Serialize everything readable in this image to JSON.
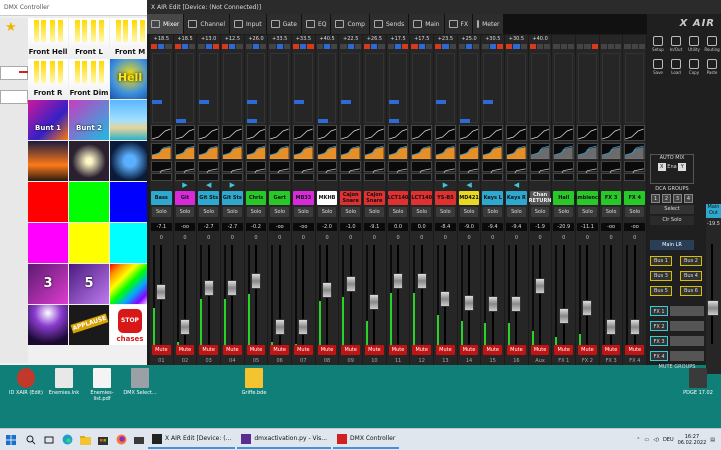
{
  "dmx": {
    "title": "DMX Controller",
    "tiles": [
      {
        "label": "Front Hell",
        "kind": "light"
      },
      {
        "label": "Front L",
        "kind": "light"
      },
      {
        "label": "Front M",
        "kind": "light"
      },
      {
        "label": "Front R",
        "kind": "light"
      },
      {
        "label": "Front Dim",
        "kind": "light"
      },
      {
        "label": "Hell",
        "kind": "hell"
      },
      {
        "label": "Bunt 1",
        "kind": "bunt1"
      },
      {
        "label": "Bunt 2",
        "kind": "bunt2"
      },
      {
        "label": "",
        "kind": "beach"
      },
      {
        "label": "",
        "kind": "sunset"
      },
      {
        "label": "",
        "kind": "moon"
      },
      {
        "label": "",
        "kind": "earth"
      },
      {
        "label": "",
        "kind": "red"
      },
      {
        "label": "",
        "kind": "green"
      },
      {
        "label": "",
        "kind": "blue"
      },
      {
        "label": "",
        "kind": "magenta"
      },
      {
        "label": "",
        "kind": "yellow"
      },
      {
        "label": "",
        "kind": "cyan"
      },
      {
        "label": "3",
        "kind": "three"
      },
      {
        "label": "5",
        "kind": "five"
      },
      {
        "label": "",
        "kind": "rainbow"
      },
      {
        "label": "",
        "kind": "crowd"
      },
      {
        "label": "",
        "kind": "applause"
      },
      {
        "label": "chases",
        "kind": "chases"
      }
    ],
    "applause_text": "APPLAUSE",
    "stop_text": "STOP"
  },
  "xair": {
    "title": "X AIR Edit [Device: (Not Connected)]",
    "tabs": [
      {
        "label": "Mixer",
        "active": true
      },
      {
        "label": "Channel",
        "active": false
      },
      {
        "label": "Input",
        "active": false
      },
      {
        "label": "Gate",
        "active": false
      },
      {
        "label": "EQ",
        "active": false
      },
      {
        "label": "Comp",
        "active": false
      },
      {
        "label": "Sends",
        "active": false
      },
      {
        "label": "Main",
        "active": false
      },
      {
        "label": "FX",
        "active": false
      },
      {
        "label": "Meter",
        "active": false
      }
    ],
    "logo": "X AIR",
    "channels": [
      {
        "gain": "+18.5",
        "name": "Bass",
        "color": "#2fa8d0",
        "level": "-7.1",
        "pan": "",
        "num": "01",
        "fader": 0.58,
        "meter": 0.42,
        "eq": "#ff9d2a"
      },
      {
        "gain": "+18.5",
        "name": "Git",
        "color": "#d82ad8",
        "level": "-oo",
        "pan": "▶",
        "num": "02",
        "fader": 0.2,
        "meter": 0.1,
        "eq": "#ff9d2a"
      },
      {
        "gain": "+13.0",
        "name": "Git Sts",
        "color": "#2fa8d0",
        "level": "-2.7",
        "pan": "◀",
        "num": "03",
        "fader": 0.62,
        "meter": 0.5,
        "eq": "#ff9d2a"
      },
      {
        "gain": "+12.5",
        "name": "Git Sts",
        "color": "#2fa8d0",
        "level": "-2.7",
        "pan": "▶",
        "num": "04",
        "fader": 0.62,
        "meter": 0.5,
        "eq": "#ff9d2a"
      },
      {
        "gain": "+26.0",
        "name": "Chris",
        "color": "#28c828",
        "level": "-0.2",
        "pan": "",
        "num": "05",
        "fader": 0.7,
        "meter": 0.55,
        "eq": "#ff9d2a"
      },
      {
        "gain": "+33.5",
        "name": "Gert",
        "color": "#28c828",
        "level": "-oo",
        "pan": "",
        "num": "06",
        "fader": 0.2,
        "meter": 0.1,
        "eq": "#ff9d2a"
      },
      {
        "gain": "+33.5",
        "name": "MB33",
        "color": "#d82ad8",
        "level": "-oo",
        "pan": "",
        "num": "07",
        "fader": 0.2,
        "meter": 0.08,
        "eq": "#ff9d2a"
      },
      {
        "gain": "+40.5",
        "name": "MKHB",
        "color": "#ffffff",
        "level": "-2.0",
        "pan": "",
        "num": "08",
        "fader": 0.6,
        "meter": 0.48,
        "eq": "#ff9d2a"
      },
      {
        "gain": "+22.5",
        "name": "Cajon Snare",
        "color": "#e03030",
        "level": "-1.0",
        "pan": "",
        "num": "09",
        "fader": 0.66,
        "meter": 0.52,
        "eq": "#ff9d2a"
      },
      {
        "gain": "+26.5",
        "name": "Cajon Snare",
        "color": "#e03030",
        "level": "-9.1",
        "pan": "",
        "num": "10",
        "fader": 0.47,
        "meter": 0.3,
        "eq": "#ff9d2a"
      },
      {
        "gain": "+17.5",
        "name": "LCT140",
        "color": "#e03030",
        "level": "0.0",
        "pan": "",
        "num": "11",
        "fader": 0.7,
        "meter": 0.56,
        "eq": "#ff9d2a"
      },
      {
        "gain": "+17.5",
        "name": "LCT140",
        "color": "#e03030",
        "level": "0.0",
        "pan": "",
        "num": "12",
        "fader": 0.7,
        "meter": 0.56,
        "eq": "#ff9d2a"
      },
      {
        "gain": "+23.5",
        "name": "YS-B5",
        "color": "#e03030",
        "level": "-8.4",
        "pan": "▶",
        "num": "13",
        "fader": 0.5,
        "meter": 0.35,
        "eq": "#ff9d2a"
      },
      {
        "gain": "+25.0",
        "name": "MD421",
        "color": "#e8d820",
        "level": "-9.0",
        "pan": "◀",
        "num": "14",
        "fader": 0.46,
        "meter": 0.3,
        "eq": "#ff9d2a"
      },
      {
        "gain": "+30.5",
        "name": "Keys L",
        "color": "#2fa8d0",
        "level": "-9.4",
        "pan": "",
        "num": "15",
        "fader": 0.45,
        "meter": 0.28,
        "eq": "#ff9d2a"
      },
      {
        "gain": "+30.5",
        "name": "Keys R",
        "color": "#2fa8d0",
        "level": "-9.4",
        "pan": "◀",
        "num": "16",
        "fader": 0.45,
        "meter": 0.28,
        "eq": "#ff9d2a"
      },
      {
        "gain": "+40.0",
        "name": "Chan RETURN",
        "color": "#555555",
        "level": "-1.9",
        "pan": "",
        "num": "Aux",
        "fader": 0.64,
        "meter": 0.2,
        "eq": "#777777"
      },
      {
        "gain": "",
        "name": "Hall",
        "color": "#28c828",
        "level": "-20.9",
        "pan": "",
        "num": "FX 1",
        "fader": 0.32,
        "meter": 0.15,
        "eq": "#777777"
      },
      {
        "gain": "",
        "name": "Ambience",
        "color": "#28c828",
        "level": "-11.1",
        "pan": "",
        "num": "FX 2",
        "fader": 0.4,
        "meter": 0.18,
        "eq": "#777777"
      },
      {
        "gain": "",
        "name": "FX 3",
        "color": "#28c828",
        "level": "-oo",
        "pan": "",
        "num": "FX 3",
        "fader": 0.2,
        "meter": 0.05,
        "eq": "#777777"
      },
      {
        "gain": "",
        "name": "FX 4",
        "color": "#28c828",
        "level": "-oo",
        "pan": "",
        "num": "FX 4",
        "fader": 0.2,
        "meter": 0.05,
        "eq": "#777777"
      }
    ],
    "solo_label": "Solo",
    "mute_label": "Mute",
    "zero_mark": "0",
    "right": {
      "icons": [
        "Setup",
        "In/Out",
        "Utility",
        "Routing",
        "Save",
        "Load",
        "Copy",
        "Paste"
      ],
      "automix": "AUTO MIX",
      "automix_x": "X",
      "automix_y": "Y",
      "automix_ena": "Ena",
      "dca_title": "DCA GROUPS",
      "dca": [
        "1",
        "2",
        "3",
        "4"
      ],
      "select": "Select",
      "clr_solo": "Clr Solo",
      "main_lr": "Main LR",
      "buses": [
        "Bus 1",
        "Bus 2",
        "Bus 3",
        "Bus 4",
        "Bus 5",
        "Bus 6"
      ],
      "fx": [
        "FX 1",
        "FX 2",
        "FX 3",
        "FX 4"
      ],
      "mute_groups": "MUTE GROUPS",
      "main_name": "Main Out",
      "main_level": "-19.5"
    }
  },
  "desktop": {
    "icons": [
      {
        "label": "ID XAIR (Edit)",
        "pos": 8
      },
      {
        "label": "Enemies.lnk",
        "pos": 46
      },
      {
        "label": "Enemies-list.pdf",
        "pos": 84
      },
      {
        "label": "DMX Select...",
        "pos": 122
      },
      {
        "label": "Griffe.bde",
        "pos": 236
      },
      {
        "label": "PDGE 17.02",
        "pos": 680
      }
    ]
  },
  "taskbar": {
    "apps": [
      {
        "label": "X AIR Edit [Device: (...",
        "color": "#222"
      },
      {
        "label": "dmxactivation.py - Vis...",
        "color": "#5c2d91"
      },
      {
        "label": "DMX Controller",
        "color": "#d02020"
      }
    ],
    "lang": "DEU",
    "time": "16:27",
    "date": "06.02.2022"
  }
}
